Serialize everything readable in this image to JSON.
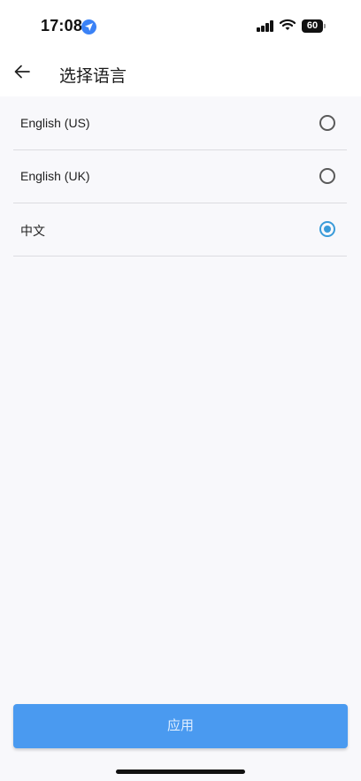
{
  "status_bar": {
    "time": "17:08",
    "battery": "60",
    "icons": [
      "location-icon",
      "signal-icon",
      "wifi-icon",
      "battery-icon"
    ]
  },
  "header": {
    "title": "选择语言",
    "back_icon": "arrow-left-icon"
  },
  "languages": [
    {
      "label": "English (US)",
      "selected": false
    },
    {
      "label": "English (UK)",
      "selected": false
    },
    {
      "label": "中文",
      "selected": true
    }
  ],
  "apply_button": {
    "label": "应用"
  },
  "colors": {
    "accent": "#4a9af0",
    "radio_selected": "#3a9bd9",
    "background": "#f8f8fb"
  }
}
